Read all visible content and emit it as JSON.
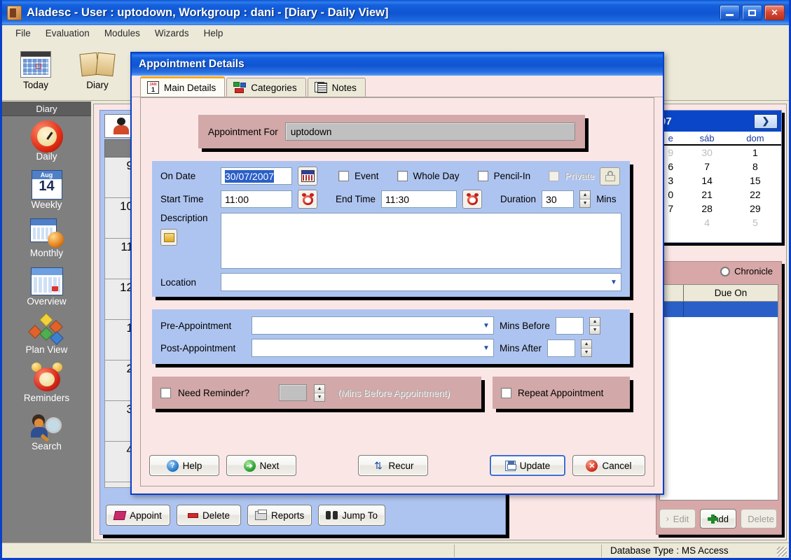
{
  "window": {
    "title": "Aladesc - User : uptodown, Workgroup : dani - [Diary - Daily View]",
    "minimize_label": "_",
    "maximize_label": "□",
    "close_label": "✕"
  },
  "menubar": {
    "items": [
      "File",
      "Evaluation",
      "Modules",
      "Wizards",
      "Help"
    ]
  },
  "toolbar": {
    "items": [
      {
        "label": "Today",
        "icon": "calendar-today-icon"
      },
      {
        "label": "Diary",
        "icon": "open-book-icon"
      }
    ]
  },
  "sidebar": {
    "header": "Diary",
    "items": [
      {
        "label": "Daily",
        "icon": "red-clock-icon"
      },
      {
        "label": "Weekly",
        "icon": "calendar-14-icon"
      },
      {
        "label": "Monthly",
        "icon": "calendar-clock-icon"
      },
      {
        "label": "Overview",
        "icon": "calendar-overview-icon"
      },
      {
        "label": "Plan View",
        "icon": "network-nodes-icon"
      },
      {
        "label": "Reminders",
        "icon": "alarm-clock-icon"
      },
      {
        "label": "Search",
        "icon": "person-magnifier-icon"
      }
    ]
  },
  "daily_view": {
    "person_icon": "person-icon",
    "hours": [
      "9",
      "10",
      "11",
      "12",
      "1",
      "2",
      "3",
      "4"
    ],
    "buttons": [
      {
        "label": "Appoint",
        "accel": "A",
        "icon": "appointment-tag-icon",
        "disabled": false
      },
      {
        "label": "Delete",
        "accel": "D",
        "icon": "delete-icon",
        "disabled": false
      },
      {
        "label": "Reports",
        "accel": "R",
        "icon": "printer-icon",
        "disabled": false
      },
      {
        "label": "Jump To",
        "accel": "J",
        "icon": "binoculars-icon",
        "disabled": false
      }
    ]
  },
  "mini_calendar": {
    "title_fragment": "07",
    "next_label": "❯",
    "weekday_headers": [
      "e",
      "sáb",
      "dom"
    ],
    "weeks": [
      [
        {
          "d": "9",
          "dim": true
        },
        {
          "d": "30",
          "dim": true
        },
        {
          "d": "1",
          "dim": false
        }
      ],
      [
        {
          "d": "6",
          "dim": false
        },
        {
          "d": "7",
          "dim": false
        },
        {
          "d": "8",
          "dim": false
        }
      ],
      [
        {
          "d": "3",
          "dim": false
        },
        {
          "d": "14",
          "dim": false
        },
        {
          "d": "15",
          "dim": false
        }
      ],
      [
        {
          "d": "0",
          "dim": false
        },
        {
          "d": "21",
          "dim": false
        },
        {
          "d": "22",
          "dim": false
        }
      ],
      [
        {
          "d": "7",
          "dim": false
        },
        {
          "d": "28",
          "dim": false
        },
        {
          "d": "29",
          "dim": false
        }
      ],
      [
        {
          "d": "",
          "dim": true
        },
        {
          "d": "4",
          "dim": true
        },
        {
          "d": "5",
          "dim": true
        }
      ]
    ]
  },
  "chronicle": {
    "radio_label": "Chronicle",
    "columns": [
      "",
      "Due On"
    ],
    "buttons": [
      {
        "label": "Edit",
        "accel": "E",
        "icon": "chevron-icon",
        "disabled": true
      },
      {
        "label": "Add",
        "accel": "A",
        "icon": "plus-icon",
        "disabled": false
      },
      {
        "label": "Delete",
        "accel": "D",
        "icon": "dash-icon",
        "disabled": true
      }
    ]
  },
  "statusbar": {
    "database_type": "Database Type : MS Access"
  },
  "dialog": {
    "title": "Appointment Details",
    "tabs": [
      {
        "label": "Main Details",
        "icon": "calendar-page-icon",
        "active": true
      },
      {
        "label": "Categories",
        "icon": "color-blocks-icon",
        "active": false
      },
      {
        "label": "Notes",
        "icon": "stacked-pages-icon",
        "active": false
      }
    ],
    "appointment_for": {
      "label": "Appointment For",
      "value": "uptodown"
    },
    "main": {
      "on_date_label": "On Date",
      "on_date_value": "30/07/2007",
      "date_picker_icon": "calendar-picker-icon",
      "event_label": "Event",
      "event_checked": false,
      "whole_day_label": "Whole Day",
      "whole_day_checked": false,
      "pencil_in_label": "Pencil-In",
      "pencil_in_checked": false,
      "private_label": "Private",
      "private_checked": false,
      "private_disabled": true,
      "lock_icon": "lock-icon",
      "start_time_label": "Start Time",
      "start_time_value": "11:00",
      "start_alarm_icon": "alarm-clock-icon",
      "end_time_label": "End Time",
      "end_time_value": "11:30",
      "end_alarm_icon": "alarm-clock-icon",
      "duration_label": "Duration",
      "duration_value": "30",
      "duration_units": "Mins",
      "description_label": "Description",
      "description_value": "",
      "description_icon": "description-folder-icon",
      "location_label": "Location",
      "location_value": ""
    },
    "prepost": {
      "pre_label": "Pre-Appointment",
      "pre_value": "",
      "mins_before_label": "Mins Before",
      "mins_before_value": "",
      "post_label": "Post-Appointment",
      "post_value": "",
      "mins_after_label": "Mins After",
      "mins_after_value": ""
    },
    "reminder": {
      "need_reminder_label": "Need Reminder?",
      "need_reminder_checked": false,
      "mins_value": "",
      "hint": "(Mins Before Appointment)",
      "repeat_label": "Repeat Appointment",
      "repeat_checked": false
    },
    "buttons": [
      {
        "label": "Help",
        "accel": "H",
        "icon": "help-icon",
        "style": "normal"
      },
      {
        "label": "Next",
        "accel": "N",
        "icon": "next-icon",
        "style": "normal"
      },
      {
        "label": "Recur",
        "accel": "R",
        "icon": "recur-icon",
        "style": "normal"
      },
      {
        "label": "Update",
        "accel": "U",
        "icon": "save-icon",
        "style": "default"
      },
      {
        "label": "Cancel",
        "accel": "C",
        "icon": "cancel-icon",
        "style": "normal"
      }
    ]
  },
  "colors": {
    "titlebar_blue": "#0f55d2",
    "dialog_body_pink": "#fbe6e6",
    "group_blue": "#aec4f0",
    "group_rose": "#d2a8a8",
    "sidebar_gray": "#7f7f7f",
    "selection_blue": "#2a5fc8",
    "tab_accent_orange": "#f0a92a"
  }
}
